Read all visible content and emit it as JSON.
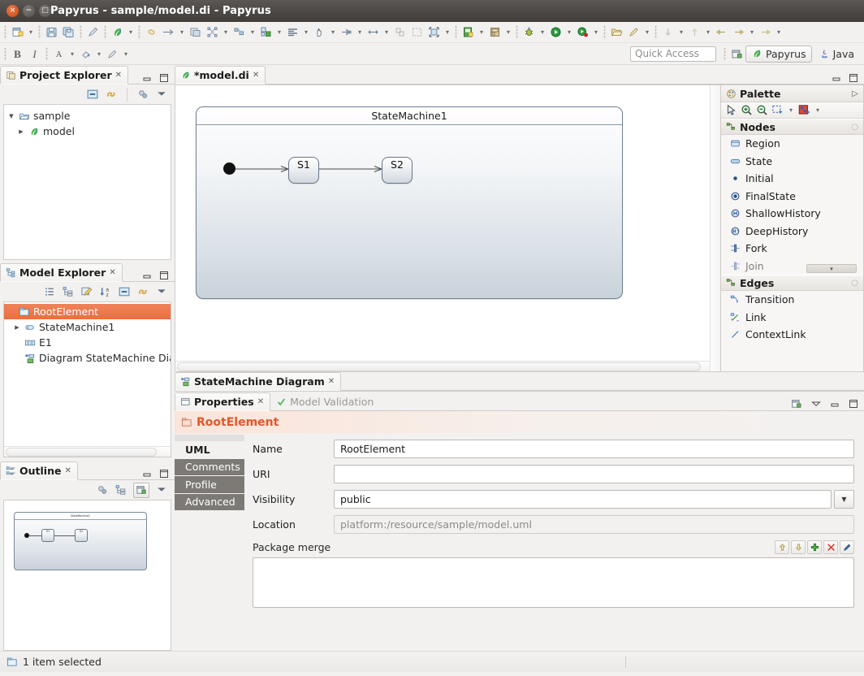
{
  "window": {
    "title": "Papyrus - sample/model.di - Papyrus",
    "buttons": {
      "close": "close-window",
      "minimize": "minimize-window",
      "maximize": "maximize-window"
    }
  },
  "toolbar": {
    "quick_access_placeholder": "Quick Access",
    "perspectives": [
      {
        "label": "Papyrus",
        "active": true
      },
      {
        "label": "Java",
        "active": false
      }
    ],
    "format_buttons": {
      "bold": "B",
      "italic": "I"
    }
  },
  "project_explorer": {
    "tab": "Project Explorer",
    "tree": [
      {
        "label": "sample",
        "twisty": "open",
        "depth": 0,
        "icon": "project-folder-icon"
      },
      {
        "label": "model",
        "twisty": "closed",
        "depth": 1,
        "icon": "papyrus-model-icon"
      }
    ]
  },
  "model_explorer": {
    "tab": "Model Explorer",
    "tree": [
      {
        "label": "RootElement",
        "twisty": "none",
        "depth": 0,
        "icon": "package-icon",
        "selected": true
      },
      {
        "label": "StateMachine1",
        "twisty": "closed",
        "depth": 1,
        "icon": "statemachine-icon",
        "selected": false
      },
      {
        "label": "E1",
        "twisty": "none",
        "depth": 1,
        "icon": "enumeration-icon",
        "selected": false
      },
      {
        "label": "Diagram StateMachine Diagr",
        "twisty": "none",
        "depth": 1,
        "icon": "diagram-icon",
        "selected": false
      }
    ]
  },
  "outline": {
    "tab": "Outline",
    "thumbnail_title": "StateMachine1",
    "states": [
      "S1",
      "S2"
    ]
  },
  "editor": {
    "tab": "*model.di",
    "bottom_tab": "StateMachine Diagram",
    "diagram": {
      "frame_title": "StateMachine1",
      "states": [
        {
          "name": "S1"
        },
        {
          "name": "S2"
        }
      ],
      "initial": "initial-pseudostate"
    }
  },
  "palette": {
    "title": "Palette",
    "tools": [
      "select-tool",
      "zoom-in-tool",
      "zoom-out-tool",
      "marquee-tool",
      "format-tool"
    ],
    "groups": [
      {
        "name": "Nodes",
        "items": [
          {
            "label": "Region",
            "icon": "region-icon"
          },
          {
            "label": "State",
            "icon": "state-icon"
          },
          {
            "label": "Initial",
            "icon": "initial-icon"
          },
          {
            "label": "FinalState",
            "icon": "finalstate-icon"
          },
          {
            "label": "ShallowHistory",
            "icon": "shallowhistory-icon"
          },
          {
            "label": "DeepHistory",
            "icon": "deephistory-icon"
          },
          {
            "label": "Fork",
            "icon": "fork-icon"
          },
          {
            "label": "Join",
            "icon": "join-icon"
          }
        ]
      },
      {
        "name": "Edges",
        "items": [
          {
            "label": "Transition",
            "icon": "transition-icon"
          },
          {
            "label": "Link",
            "icon": "link-icon"
          },
          {
            "label": "ContextLink",
            "icon": "contextlink-icon"
          }
        ]
      }
    ]
  },
  "properties": {
    "tab": "Properties",
    "secondary_tab": "Model Validation",
    "header": "RootElement",
    "tabs": [
      {
        "label": "UML",
        "active": true
      },
      {
        "label": "Comments",
        "active": false
      },
      {
        "label": "Profile",
        "active": false
      },
      {
        "label": "Advanced",
        "active": false
      }
    ],
    "fields": [
      {
        "label": "Name",
        "value": "RootElement",
        "readonly": false,
        "combo": false
      },
      {
        "label": "URI",
        "value": "",
        "readonly": false,
        "combo": false
      },
      {
        "label": "Visibility",
        "value": "public",
        "readonly": false,
        "combo": true
      },
      {
        "label": "Location",
        "value": "platform:/resource/sample/model.uml",
        "readonly": true,
        "combo": false
      }
    ],
    "package_merge": {
      "label": "Package merge",
      "buttons": [
        "move-up-button",
        "move-down-button",
        "add-button",
        "delete-button",
        "edit-button"
      ]
    }
  },
  "status_bar": {
    "text": "1 item selected",
    "icon": "package-icon"
  },
  "colors": {
    "accent": "#e2572a",
    "selection": "#e9703f",
    "titlebar": "#403c39",
    "panel": "#f2f1f0"
  }
}
